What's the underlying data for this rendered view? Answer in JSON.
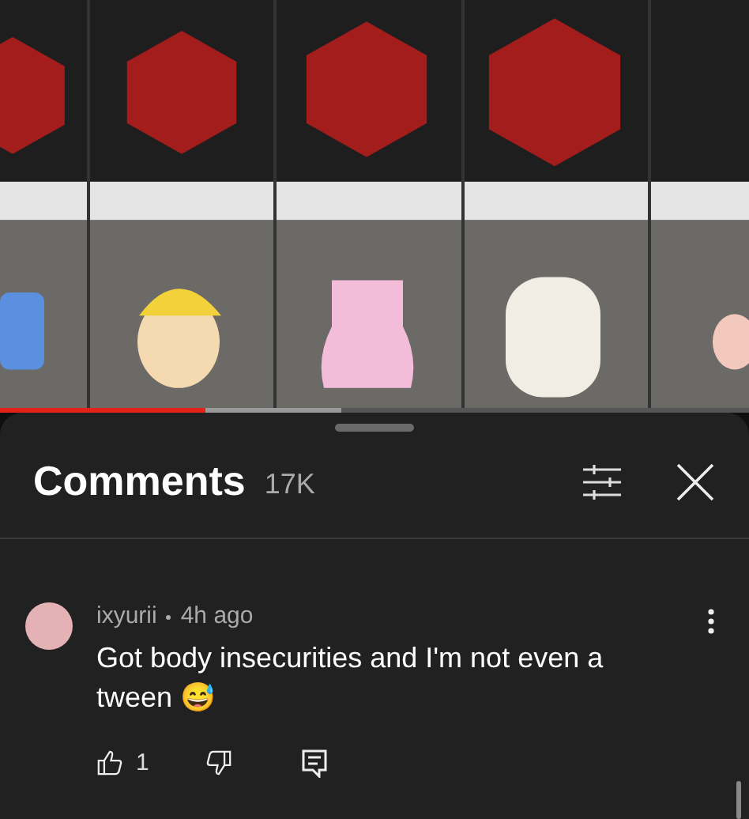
{
  "video": {
    "kind": "picture",
    "progress": {
      "level": 0.275
    },
    "buffer": {
      "level": 0.456
    }
  },
  "comments_panel": {
    "title": "Comments",
    "count": "17K",
    "comments": [
      {
        "author": "ixyurii",
        "time": "4h ago",
        "text": "Got body insecurities and I'm not even a tween 😅",
        "likes": "1"
      }
    ]
  }
}
